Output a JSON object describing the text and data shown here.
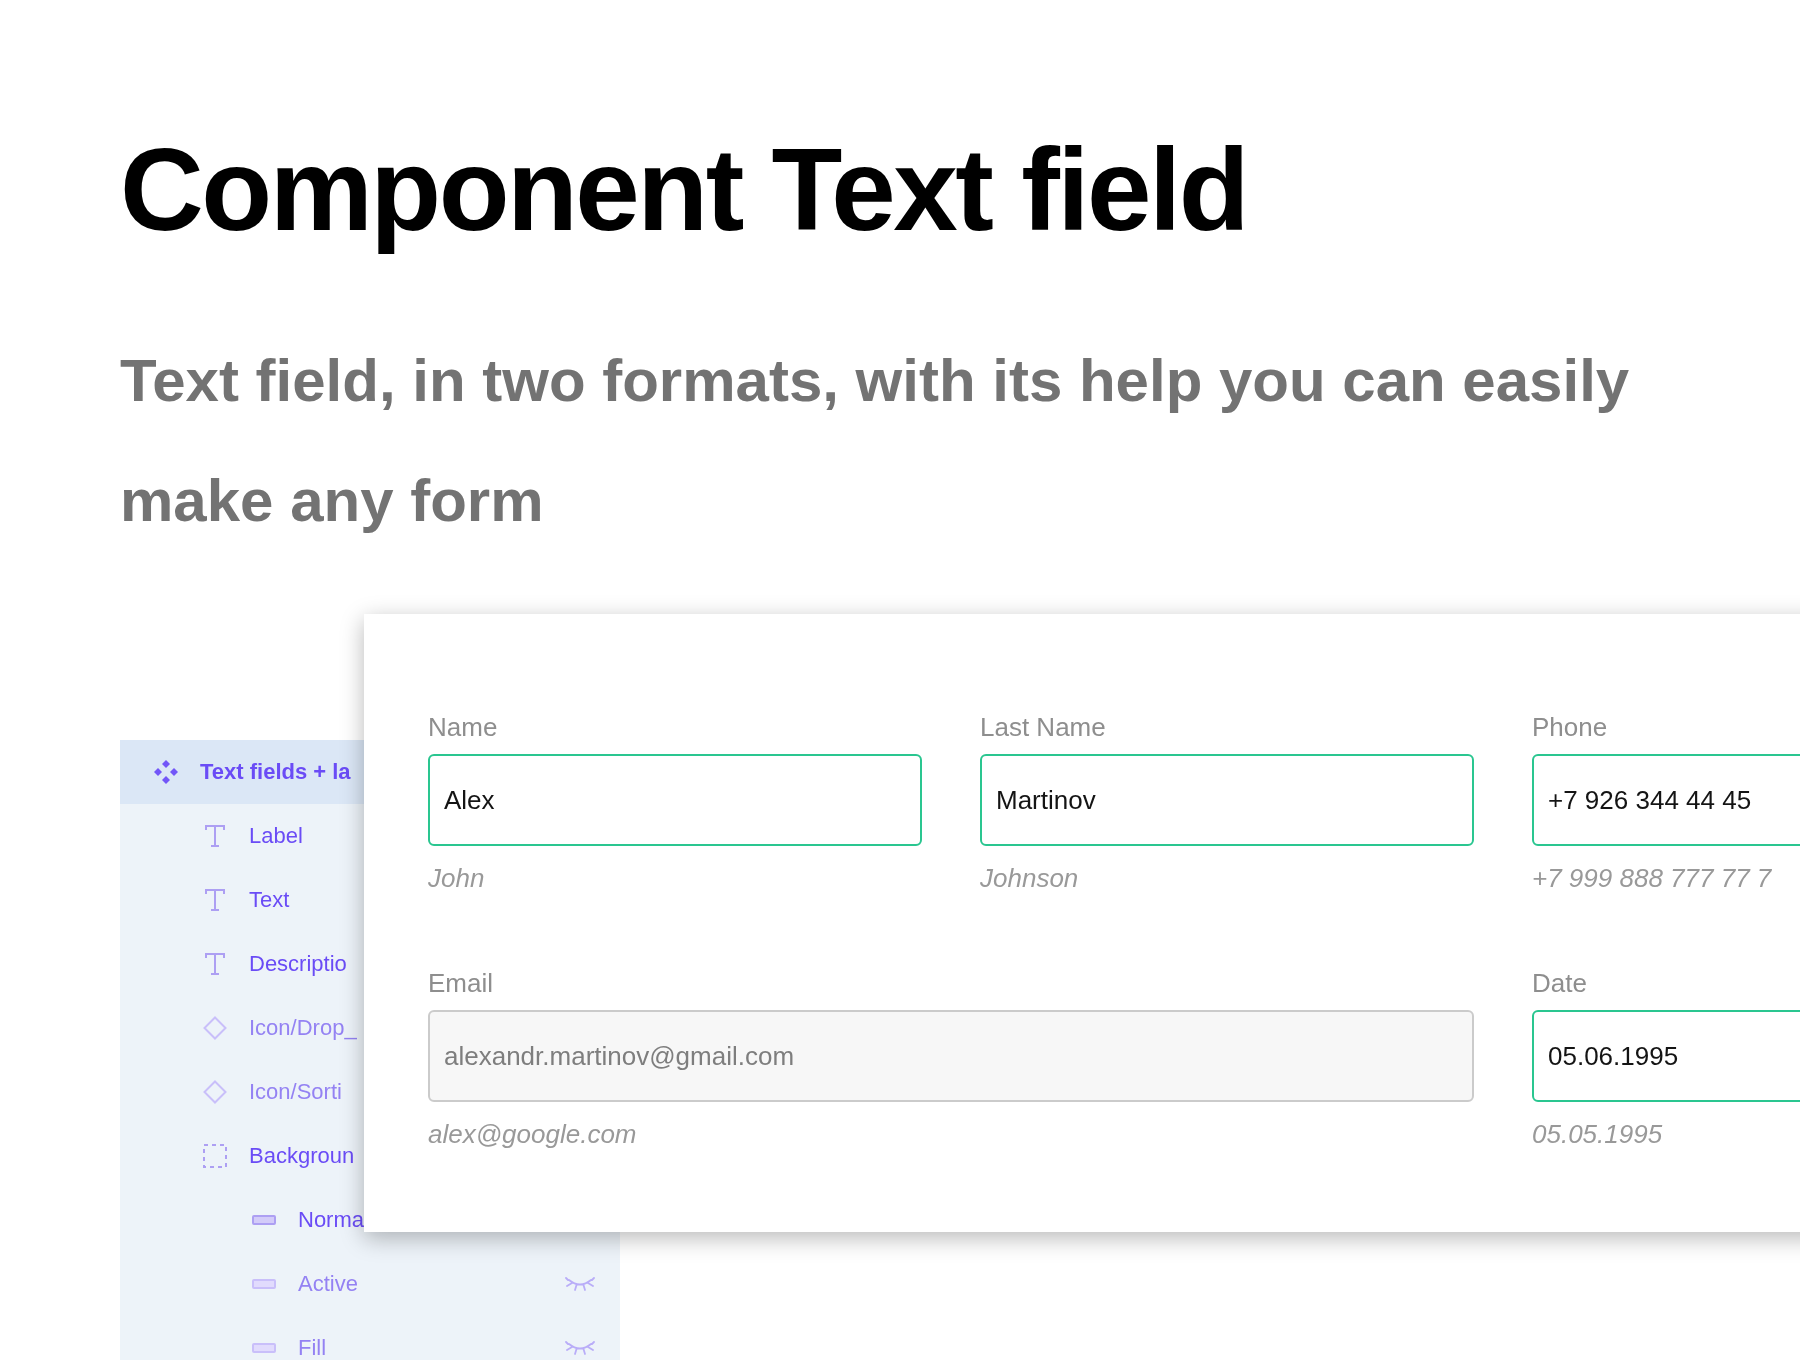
{
  "title": "Component Text field",
  "subtitle": "Text field, in two formats, with its help you can easily make any form",
  "layers_panel": {
    "items": [
      {
        "name": "Text fields + la",
        "kind": "component",
        "selected": true,
        "hidden": false,
        "children": [
          {
            "name": "Label",
            "kind": "text",
            "selected": false,
            "hidden": false
          },
          {
            "name": "Text",
            "kind": "text",
            "selected": false,
            "hidden": false
          },
          {
            "name": "Descriptio",
            "kind": "text",
            "selected": false,
            "hidden": false
          },
          {
            "name": "Icon/Drop_",
            "kind": "instance",
            "selected": false,
            "hidden": true
          },
          {
            "name": "Icon/Sorti",
            "kind": "instance",
            "selected": false,
            "hidden": true
          },
          {
            "name": "Backgroun",
            "kind": "frame",
            "selected": false,
            "hidden": false,
            "children": [
              {
                "name": "Norma",
                "kind": "rectangle",
                "selected": false,
                "hidden": false
              },
              {
                "name": "Active",
                "kind": "rectangle",
                "selected": false,
                "hidden": true
              },
              {
                "name": "Fill",
                "kind": "rectangle",
                "selected": false,
                "hidden": true
              }
            ]
          }
        ]
      }
    ]
  },
  "form": {
    "rows": [
      {
        "fields": [
          {
            "label": "Name",
            "value": "Alex",
            "description": "John",
            "disabled": false
          },
          {
            "label": "Last Name",
            "value": "Martinov",
            "description": "Johnson",
            "disabled": false
          },
          {
            "label": "Phone",
            "value": "+7 926 344 44 45",
            "description": "+7 999 888 777 77 7",
            "disabled": false
          }
        ]
      },
      {
        "fields": [
          {
            "label": "Email",
            "value": "alexandr.martinov@gmail.com",
            "description": "alex@google.com",
            "disabled": true
          },
          {
            "label": "Date",
            "value": "05.06.1995",
            "description": "05.05.1995",
            "disabled": false
          }
        ]
      }
    ]
  }
}
